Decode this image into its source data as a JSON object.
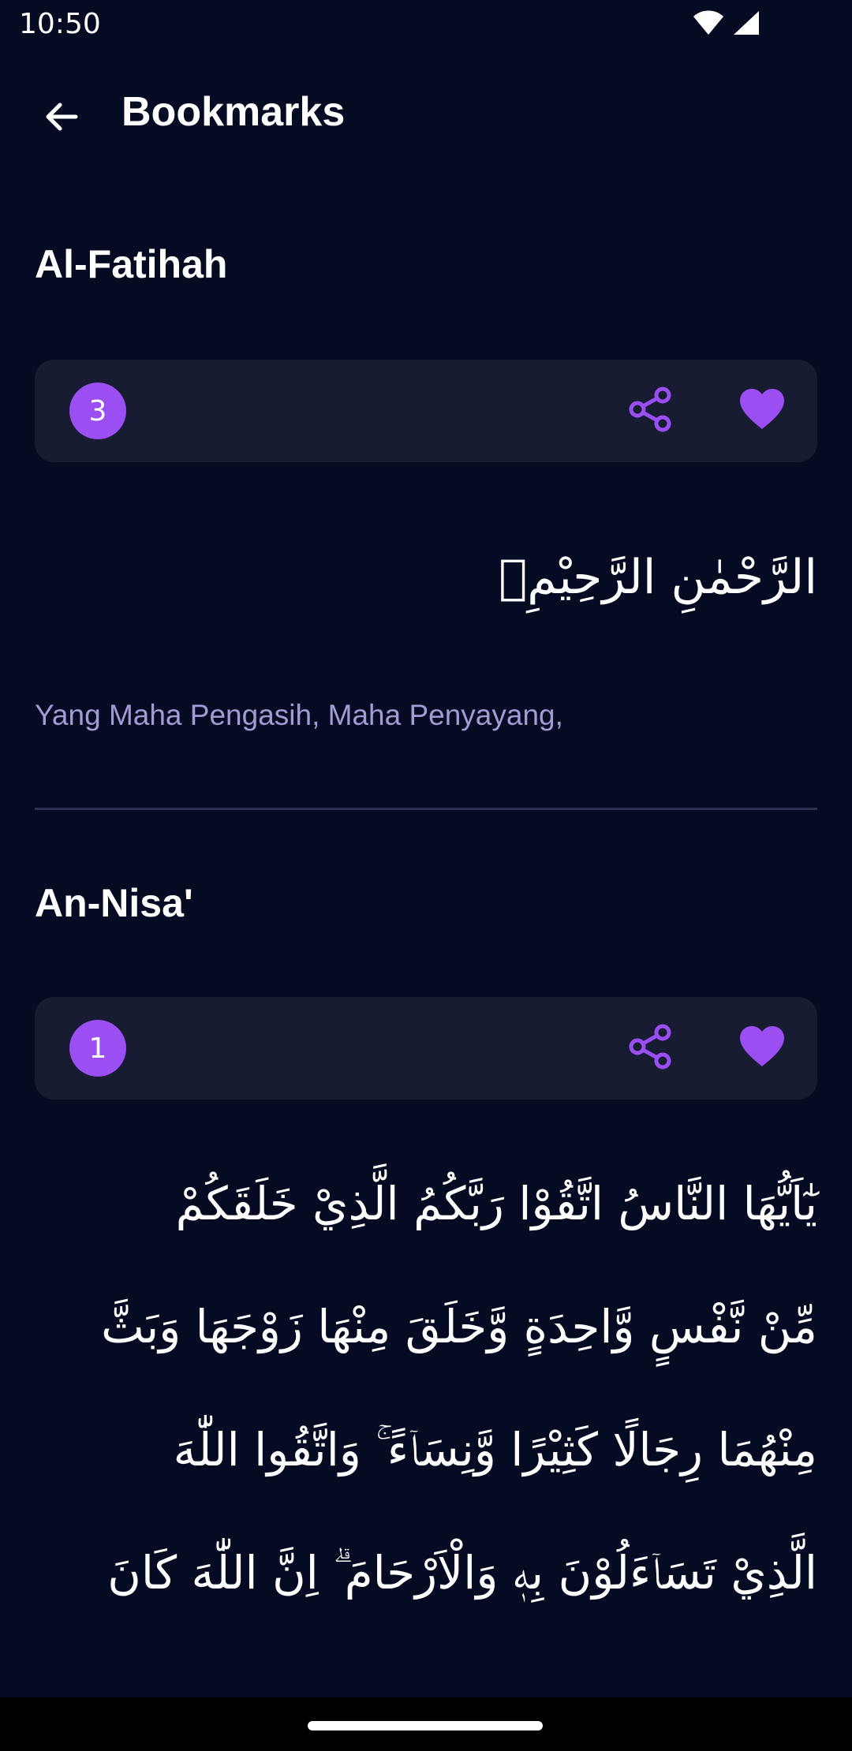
{
  "status_bar": {
    "time": "10:50",
    "icons": [
      "wifi-icon",
      "signal-icon"
    ]
  },
  "app_bar": {
    "title": "Bookmarks",
    "back_icon": "arrow-left-icon"
  },
  "colors": {
    "background": "#050b22",
    "card": "#171c33",
    "accent": "#9b4ff2",
    "translation_text": "#a39bd4"
  },
  "bookmarks": [
    {
      "surah": "Al-Fatihah",
      "ayah_number": "3",
      "arabic": "الرَّحْمٰنِ الرَّحِيْمِۙ",
      "translation": "Yang Maha Pengasih, Maha Penyayang,"
    },
    {
      "surah": "An-Nisa'",
      "ayah_number": "1",
      "arabic_lines": [
        "يٰٓاَيُّهَا النَّاسُ اتَّقُوْا رَبَّكُمُ الَّذِيْ خَلَقَكُمْ",
        "مِّنْ نَّفْسٍ وَّاحِدَةٍ وَّخَلَقَ مِنْهَا زَوْجَهَا وَبَثَّ",
        "مِنْهُمَا رِجَالًا كَثِيْرًا وَّنِسَاۤءً ۚ وَاتَّقُوا اللّٰهَ",
        "الَّذِيْ تَسَاۤءَلُوْنَ بِهٖ وَالْاَرْحَامَ ۗ اِنَّ اللّٰهَ كَانَ"
      ]
    }
  ]
}
